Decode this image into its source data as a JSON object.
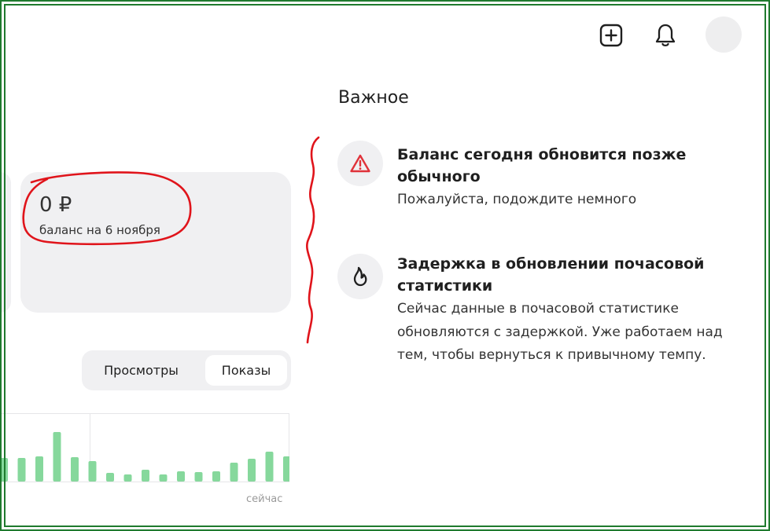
{
  "header": {
    "add_icon": "plus-square-icon",
    "bell_icon": "bell-icon"
  },
  "balance": {
    "amount": "0 ₽",
    "date_label": "баланс на 6 ноября"
  },
  "segmented": {
    "options": [
      "Просмотры",
      "Показы"
    ],
    "selected": "Показы"
  },
  "chart_data": {
    "type": "bar",
    "values": [
      30,
      30,
      32,
      63,
      31,
      26,
      11,
      9,
      15,
      9,
      13,
      12,
      13,
      24,
      29,
      38,
      32,
      35
    ],
    "xlabel_end": "сейчас",
    "bar_color": "#86d89c"
  },
  "important": {
    "title": "Важное",
    "notices": [
      {
        "icon": "warning-triangle-icon",
        "title": "Баланс сегодня обновится позже обычного",
        "text": "Пожалуйста, подождите немного"
      },
      {
        "icon": "flame-icon",
        "title": "Задержка в обновлении почасовой статистики",
        "text": "Сейчас данные в почасовой статистике обновляются с задержкой. Уже работаем над тем, чтобы вернуться к привычному темпу."
      }
    ]
  },
  "colors": {
    "frame": "#1f7a2e",
    "annotation": "#e0141b",
    "card_bg": "#f0f0f2",
    "warning": "#e0323a"
  }
}
